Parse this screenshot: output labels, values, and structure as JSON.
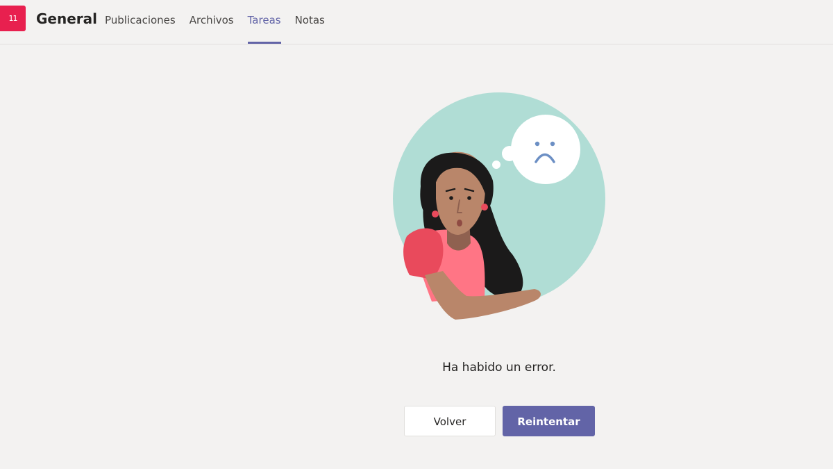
{
  "header": {
    "team_badge": "11",
    "channel_title": "General",
    "tabs": [
      {
        "label": "Publicaciones",
        "active": false
      },
      {
        "label": "Archivos",
        "active": false
      },
      {
        "label": "Tareas",
        "active": true
      },
      {
        "label": "Notas",
        "active": false
      }
    ]
  },
  "error": {
    "message": "Ha habido un error.",
    "illustration": "sad-woman-thinking-illustration"
  },
  "actions": {
    "back_label": "Volver",
    "retry_label": "Reintentar"
  },
  "colors": {
    "accent": "#6264a7",
    "team_badge": "#e8204f",
    "background": "#f3f2f1",
    "illustration_circle": "#b0ddd5"
  }
}
